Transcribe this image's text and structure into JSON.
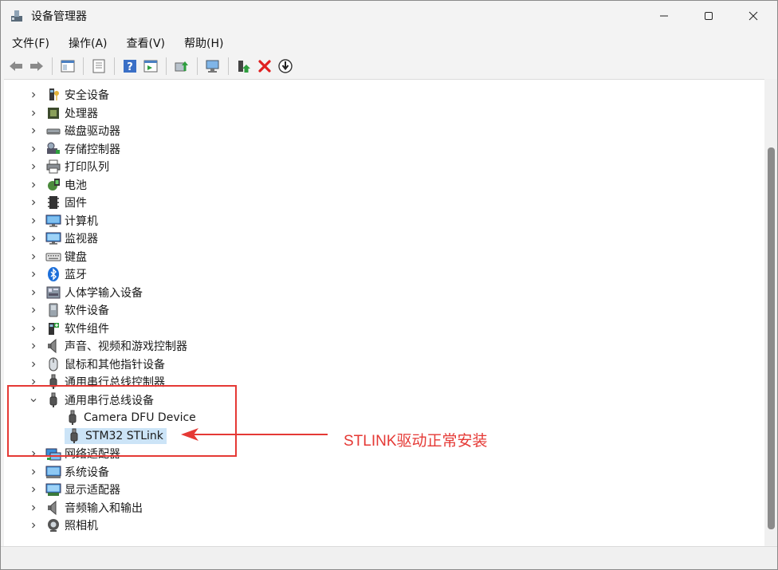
{
  "window": {
    "title": "设备管理器"
  },
  "menu": [
    "文件(F)",
    "操作(A)",
    "查看(V)",
    "帮助(H)"
  ],
  "tree": [
    {
      "label": "安全设备",
      "icon": "security-key-icon",
      "expanded": false
    },
    {
      "label": "处理器",
      "icon": "processor-icon",
      "expanded": false
    },
    {
      "label": "磁盘驱动器",
      "icon": "disk-drive-icon",
      "expanded": false
    },
    {
      "label": "存储控制器",
      "icon": "storage-controller-icon",
      "expanded": false
    },
    {
      "label": "打印队列",
      "icon": "printer-icon",
      "expanded": false
    },
    {
      "label": "电池",
      "icon": "battery-icon",
      "expanded": false
    },
    {
      "label": "固件",
      "icon": "firmware-chip-icon",
      "expanded": false
    },
    {
      "label": "计算机",
      "icon": "computer-icon",
      "expanded": false
    },
    {
      "label": "监视器",
      "icon": "monitor-icon",
      "expanded": false
    },
    {
      "label": "键盘",
      "icon": "keyboard-icon",
      "expanded": false
    },
    {
      "label": "蓝牙",
      "icon": "bluetooth-icon",
      "expanded": false
    },
    {
      "label": "人体学输入设备",
      "icon": "hid-icon",
      "expanded": false
    },
    {
      "label": "软件设备",
      "icon": "software-device-icon",
      "expanded": false
    },
    {
      "label": "软件组件",
      "icon": "software-component-icon",
      "expanded": false
    },
    {
      "label": "声音、视频和游戏控制器",
      "icon": "speaker-icon",
      "expanded": false
    },
    {
      "label": "鼠标和其他指针设备",
      "icon": "mouse-icon",
      "expanded": false
    },
    {
      "label": "通用串行总线控制器",
      "icon": "usb-icon",
      "expanded": false
    },
    {
      "label": "通用串行总线设备",
      "icon": "usb-icon",
      "expanded": true,
      "children": [
        {
          "label": "Camera DFU Device",
          "icon": "usb-icon",
          "selected": false
        },
        {
          "label": "STM32 STLink",
          "icon": "usb-icon",
          "selected": true
        }
      ]
    },
    {
      "label": "网络适配器",
      "icon": "network-adapter-icon",
      "expanded": false
    },
    {
      "label": "系统设备",
      "icon": "system-device-icon",
      "expanded": false
    },
    {
      "label": "显示适配器",
      "icon": "display-adapter-icon",
      "expanded": false
    },
    {
      "label": "音频输入和输出",
      "icon": "speaker-icon",
      "expanded": false
    },
    {
      "label": "照相机",
      "icon": "camera-icon",
      "expanded": false
    }
  ],
  "annotation": {
    "text": "STLINK驱动正常安装",
    "color": "#e53935"
  },
  "colors": {
    "selection": "#cce4f7",
    "accent": "#e53935"
  }
}
